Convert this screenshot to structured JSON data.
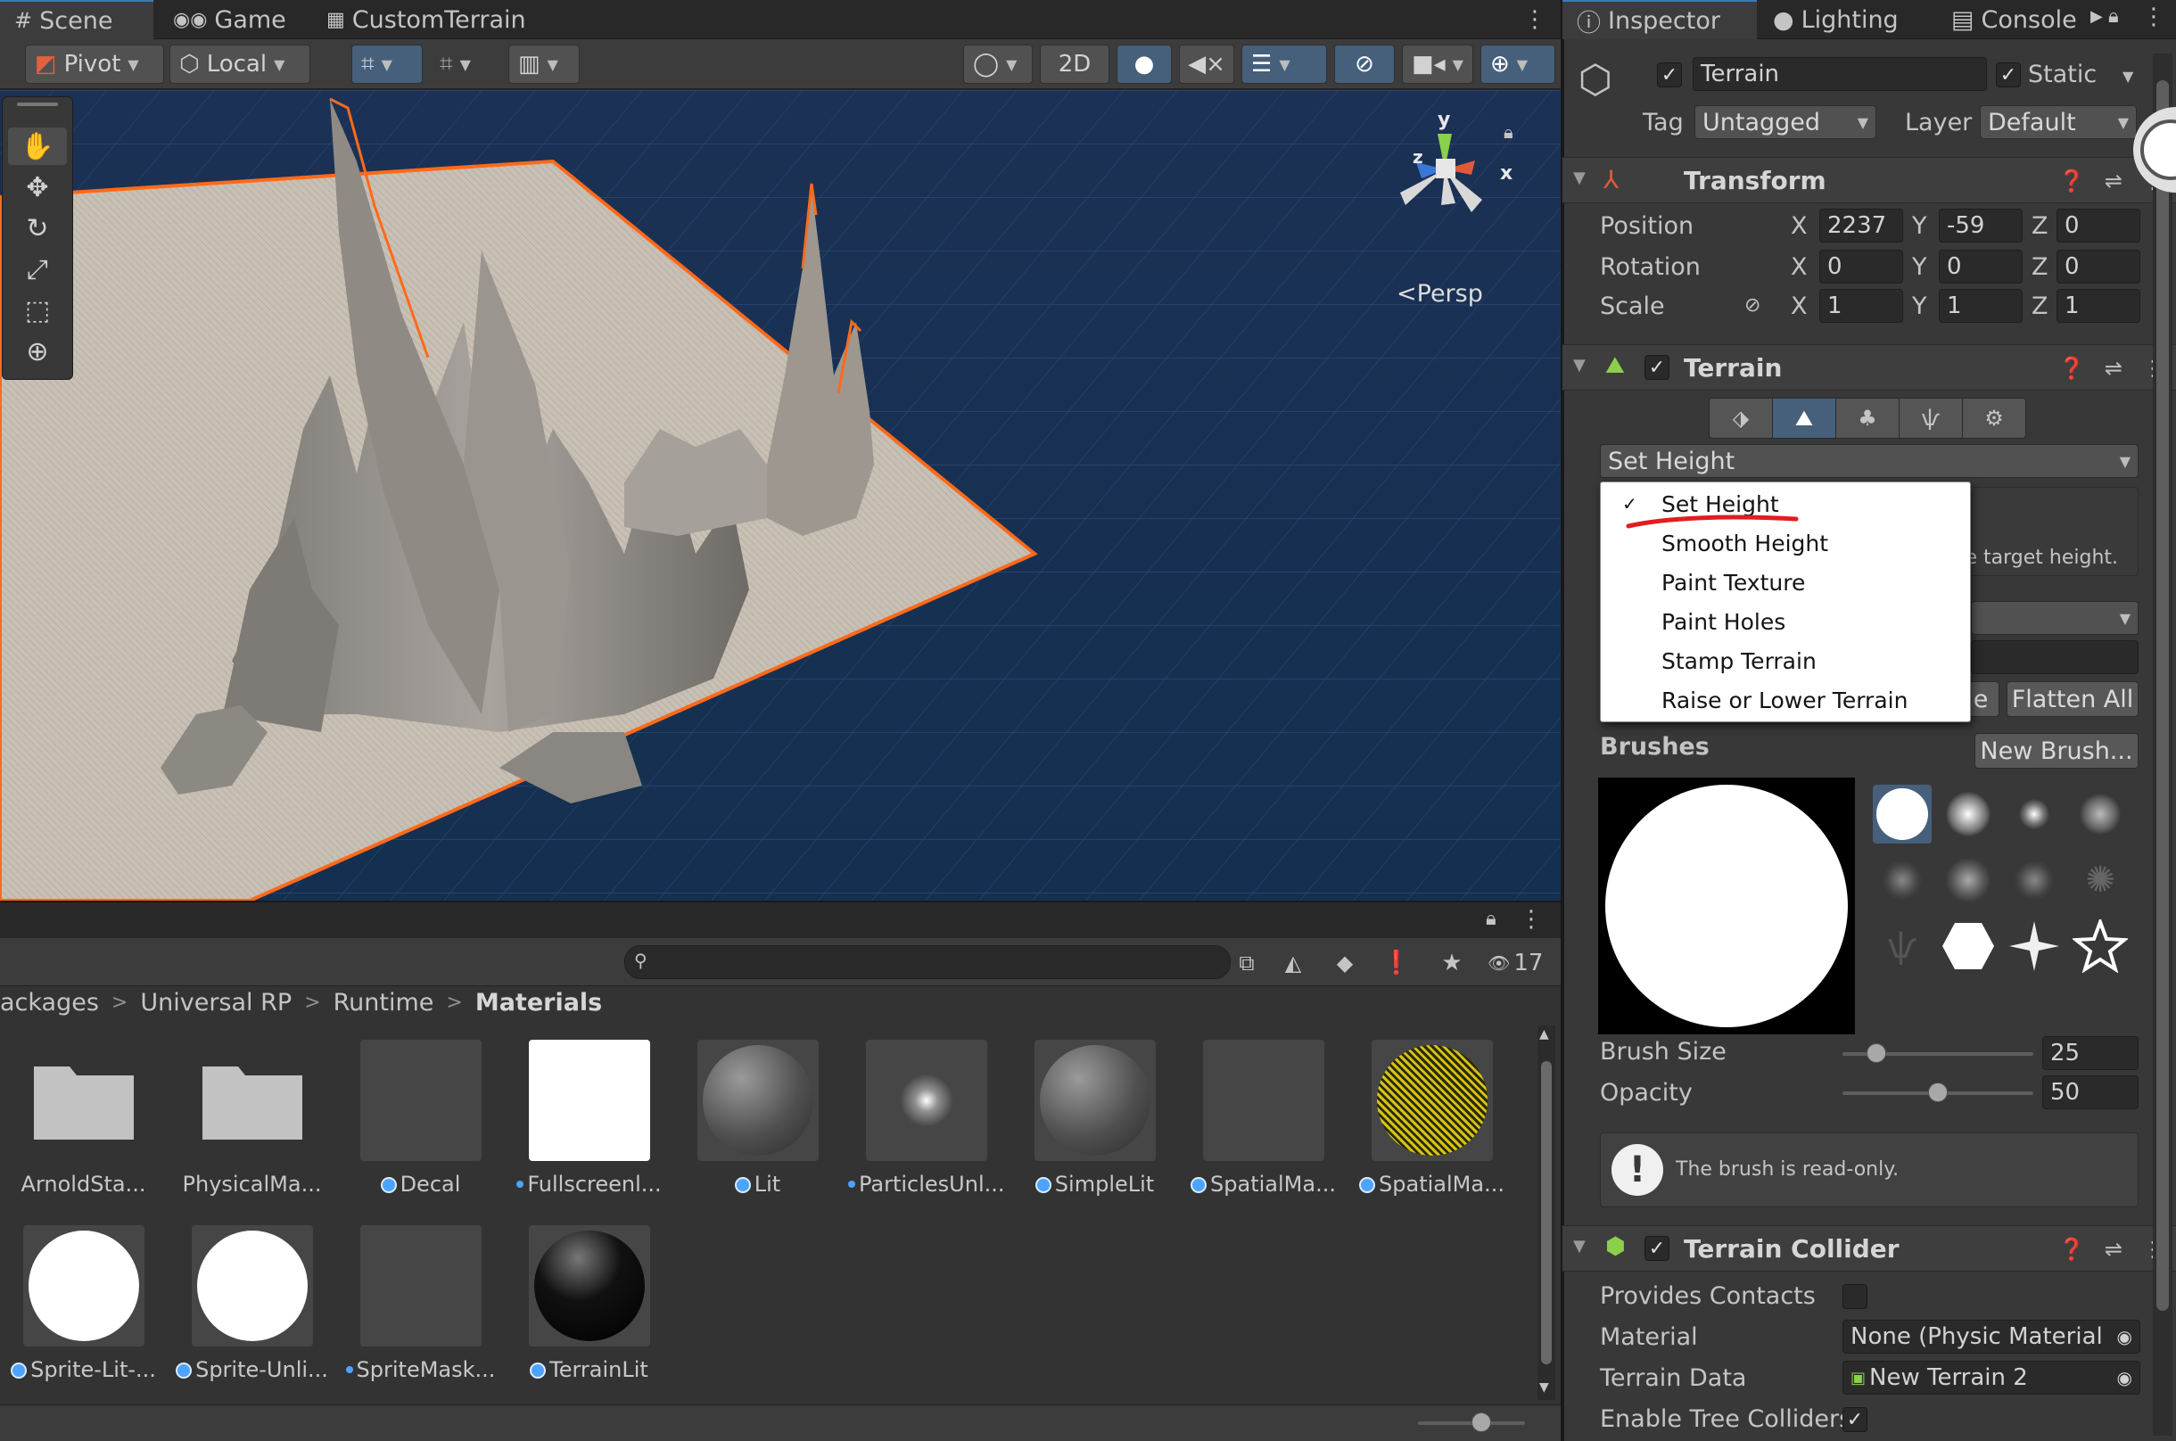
{
  "scene_window": {
    "tabs": [
      {
        "label": "Scene",
        "icon": "grid-icon"
      },
      {
        "label": "Game",
        "icon": "gamepad-icon"
      },
      {
        "label": "CustomTerrain",
        "icon": "unity-scene-icon"
      }
    ],
    "toolbar": {
      "pivot": "Pivot",
      "local": "Local",
      "mode_2d": "2D"
    },
    "gizmo": {
      "y": "y",
      "z": "z",
      "x": "x",
      "persp": "Persp"
    }
  },
  "project_window": {
    "item_count": "17",
    "breadcrumb": [
      "ackages",
      "Universal RP",
      "Runtime",
      "Materials"
    ],
    "assets": [
      {
        "label": "ArnoldSta...",
        "kind": "folder",
        "dot": "none"
      },
      {
        "label": "PhysicalMa...",
        "kind": "folder",
        "dot": "none"
      },
      {
        "label": "Decal",
        "kind": "dark",
        "dot": "big"
      },
      {
        "label": "Fullscreenl...",
        "kind": "white",
        "dot": "small"
      },
      {
        "label": "Lit",
        "kind": "sphere",
        "dot": "big"
      },
      {
        "label": "ParticlesUnl...",
        "kind": "glow",
        "dot": "small"
      },
      {
        "label": "SimpleLit",
        "kind": "sphere",
        "dot": "big"
      },
      {
        "label": "SpatialMa...",
        "kind": "dark",
        "dot": "big"
      },
      {
        "label": "SpatialMa...",
        "kind": "wire",
        "dot": "big"
      },
      {
        "label": "Sprite-Lit-...",
        "kind": "circle",
        "dot": "big"
      },
      {
        "label": "Sprite-Unli...",
        "kind": "circle",
        "dot": "big"
      },
      {
        "label": "SpriteMask...",
        "kind": "dark",
        "dot": "small"
      },
      {
        "label": "TerrainLit",
        "kind": "black-sphere",
        "dot": "big"
      }
    ]
  },
  "inspector": {
    "tabs": [
      {
        "label": "Inspector",
        "icon": "info-icon"
      },
      {
        "label": "Lighting",
        "icon": "bulb-icon"
      },
      {
        "label": "Console",
        "icon": "console-icon"
      }
    ],
    "object": {
      "name": "Terrain",
      "static_label": "Static",
      "tag_label": "Tag",
      "tag_value": "Untagged",
      "layer_label": "Layer",
      "layer_value": "Default"
    },
    "transform": {
      "title": "Transform",
      "position_label": "Position",
      "rotation_label": "Rotation",
      "scale_label": "Scale",
      "axis_x": "X",
      "axis_y": "Y",
      "axis_z": "Z",
      "position": {
        "x": "2237",
        "y": "-59",
        "z": "0"
      },
      "rotation": {
        "x": "0",
        "y": "0",
        "z": "0"
      },
      "scale": {
        "x": "1",
        "y": "1",
        "z": "1"
      }
    },
    "terrain": {
      "title": "Terrain",
      "tool_selected": "Set Height",
      "hint_fragment": "e target height.",
      "flatten_fragment": "e",
      "flatten_all": "Flatten All",
      "brushes_label": "Brushes",
      "new_brush": "New Brush...",
      "brush_size_label": "Brush Size",
      "brush_size_value": "25",
      "brush_size_fraction": 0.14,
      "opacity_label": "Opacity",
      "opacity_value": "50",
      "opacity_fraction": 0.5,
      "read_only_note": "The brush is read-only."
    },
    "menu": {
      "items": [
        "Set Height",
        "Smooth Height",
        "Paint Texture",
        "Paint Holes",
        "Stamp Terrain",
        "Raise or Lower Terrain"
      ],
      "checked_index": 0
    },
    "terrain_collider": {
      "title": "Terrain Collider",
      "provides_contacts_label": "Provides Contacts",
      "material_label": "Material",
      "material_value": "None (Physic Material",
      "terrain_data_label": "Terrain Data",
      "terrain_data_value": "New Terrain 2",
      "enable_tree_label": "Enable Tree Colliders"
    }
  },
  "colors": {
    "selection_outline": "#ff6a1a",
    "accent_blue": "#3a79bb",
    "annotation_red": "#e01e1e",
    "sky_top": "#1b3155",
    "sky_bottom": "#143050"
  }
}
